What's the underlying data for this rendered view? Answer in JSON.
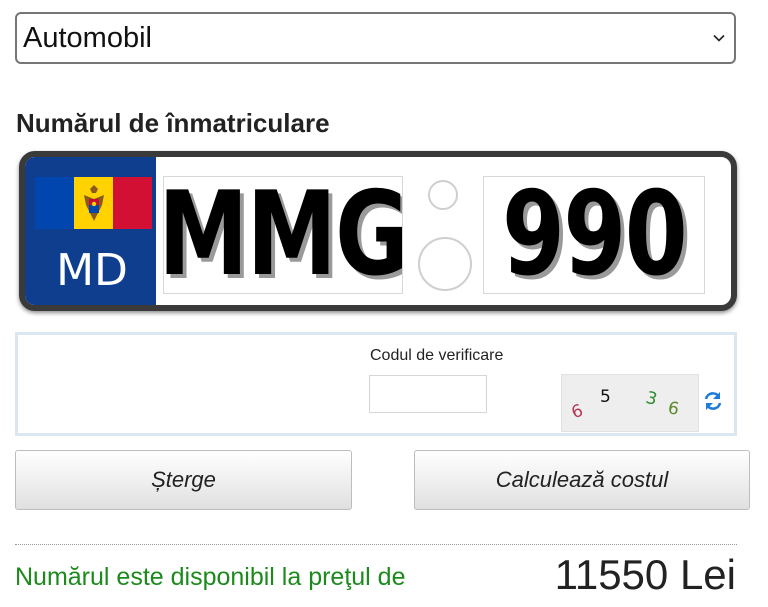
{
  "vehicle_select": {
    "value": "Automobil",
    "icon": "chevron-down-icon"
  },
  "plate_section": {
    "title": "Numărul de înmatriculare",
    "country_code": "MD",
    "letters": "MMG",
    "digits": "990",
    "flag_colors": [
      "#0046ae",
      "#ffd200",
      "#d21034"
    ],
    "band_color": "#0f3e8f"
  },
  "captcha": {
    "label": "Codul de verificare",
    "input_value": "",
    "chars": [
      "6",
      "5",
      "3",
      "6"
    ],
    "char_colors": [
      "#b03a5a",
      "#111111",
      "#2f8c2f",
      "#5a8a2a"
    ],
    "refresh_icon": "refresh-icon"
  },
  "buttons": {
    "clear_label": "Șterge",
    "calculate_label": "Calculează costul"
  },
  "result": {
    "message": "Numărul este disponibil la preţul de",
    "price": "11550 Lei",
    "message_color": "#1c8a1c"
  }
}
